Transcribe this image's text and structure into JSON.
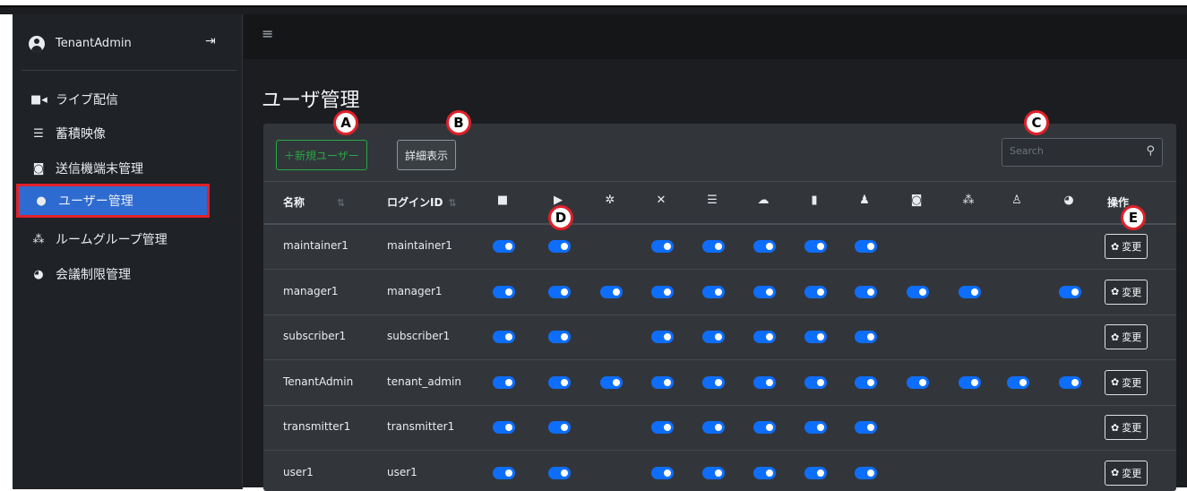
{
  "sidebar": {
    "user": {
      "name": "TenantAdmin",
      "avatar_icon": "user-circle-icon",
      "logout_icon": "sign-out-icon"
    },
    "items": [
      {
        "label": "ライブ配信",
        "icon": "video-camera-icon",
        "glyph": "■◂"
      },
      {
        "label": "蓄積映像",
        "icon": "database-icon",
        "glyph": "☰"
      },
      {
        "label": "送信機端末管理",
        "icon": "camera-icon",
        "glyph": "◙"
      },
      {
        "label": "ユーザー管理",
        "icon": "user-icon",
        "glyph": "●",
        "active": true
      },
      {
        "label": "ルームグループ管理",
        "icon": "users-icon",
        "glyph": "⁂"
      },
      {
        "label": "会議制限管理",
        "icon": "comments-icon",
        "glyph": "◕"
      }
    ]
  },
  "header": {
    "menu_glyph": "≡"
  },
  "page": {
    "title": "ユーザ管理"
  },
  "toolbar": {
    "new_user_label": "＋新規ユーザー",
    "detail_label": "詳細表示"
  },
  "search": {
    "placeholder": "Search",
    "icon_glyph": "⚲"
  },
  "table": {
    "col_name": "名称",
    "col_login": "ログインID",
    "col_ops": "操作",
    "sort_glyph": "⇅",
    "permission_icons": [
      {
        "name": "video-icon",
        "glyph": "■"
      },
      {
        "name": "play-icon",
        "glyph": "▶"
      },
      {
        "name": "users-slash-icon",
        "glyph": "✲"
      },
      {
        "name": "user-slash-icon",
        "glyph": "✕"
      },
      {
        "name": "database-icon",
        "glyph": "☰"
      },
      {
        "name": "cloud-upload-icon",
        "glyph": "☁"
      },
      {
        "name": "trash-icon",
        "glyph": "▮"
      },
      {
        "name": "user-lock-icon",
        "glyph": "♟"
      },
      {
        "name": "camera-icon",
        "glyph": "◙"
      },
      {
        "name": "users-icon",
        "glyph": "⁂"
      },
      {
        "name": "user-icon",
        "glyph": "♙"
      },
      {
        "name": "comments-icon",
        "glyph": "◕"
      }
    ],
    "edit_label": "変更",
    "edit_glyph": "✿",
    "rows": [
      {
        "name": "maintainer1",
        "login": "maintainer1",
        "perms": [
          1,
          1,
          0,
          1,
          1,
          1,
          1,
          1,
          0,
          0,
          0,
          0
        ]
      },
      {
        "name": "manager1",
        "login": "manager1",
        "perms": [
          1,
          1,
          1,
          1,
          1,
          1,
          1,
          1,
          1,
          1,
          0,
          1
        ]
      },
      {
        "name": "subscriber1",
        "login": "subscriber1",
        "perms": [
          1,
          1,
          0,
          1,
          1,
          1,
          1,
          1,
          0,
          0,
          0,
          0
        ]
      },
      {
        "name": "TenantAdmin",
        "login": "tenant_admin",
        "perms": [
          1,
          1,
          1,
          1,
          1,
          1,
          1,
          1,
          1,
          1,
          1,
          1
        ]
      },
      {
        "name": "transmitter1",
        "login": "transmitter1",
        "perms": [
          1,
          1,
          0,
          1,
          1,
          1,
          1,
          1,
          0,
          0,
          0,
          0
        ]
      },
      {
        "name": "user1",
        "login": "user1",
        "perms": [
          1,
          1,
          0,
          1,
          1,
          1,
          1,
          1,
          0,
          0,
          0,
          0
        ]
      }
    ]
  },
  "markers": [
    "A",
    "B",
    "C",
    "D",
    "E"
  ],
  "colors": {
    "accent": "#0d6efd",
    "success": "#28a745",
    "marker_border": "#e0202a",
    "active_nav": "#2e6bd1"
  }
}
